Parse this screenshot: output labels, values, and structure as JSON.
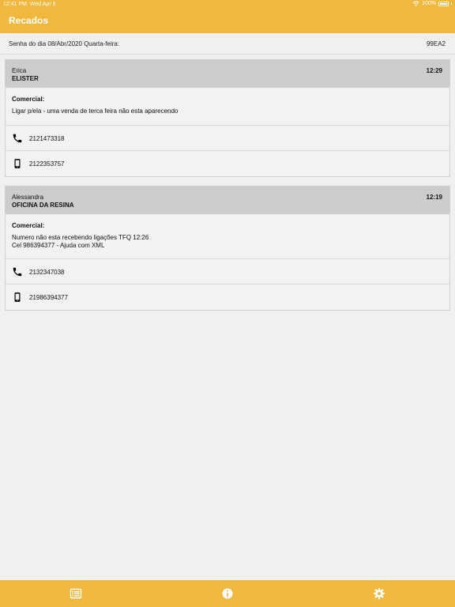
{
  "status_bar": {
    "time": "12:41 PM",
    "date": "Wed Apr 8",
    "battery": "100%"
  },
  "header": {
    "title": "Recados"
  },
  "password": {
    "label": "Senha do dia 08/Abr/2020 Quarta-feira:",
    "code": "99EA2"
  },
  "messages": [
    {
      "name": "Erica",
      "company": "ELISTER",
      "time": "12:29",
      "category": "Comercial:",
      "text": "Ligar p/ela - uma venda de terca feira não esta aparecendo",
      "phone": "2121473318",
      "mobile": "2122353757"
    },
    {
      "name": "Alessandra",
      "company": "OFICINA DA RESINA",
      "time": "12:19",
      "category": "Comercial:",
      "text": "Numero não esta recebendo ligações TFQ 12:26\nCel 986394377 - Ajuda com XML",
      "phone": "2132347038",
      "mobile": "21986394377"
    }
  ],
  "tabbar": {
    "items": [
      "list-icon",
      "info-icon",
      "gear-icon"
    ]
  },
  "colors": {
    "accent": "#f0b83e",
    "card_header": "#cccccc",
    "background": "#f0f0f0"
  }
}
